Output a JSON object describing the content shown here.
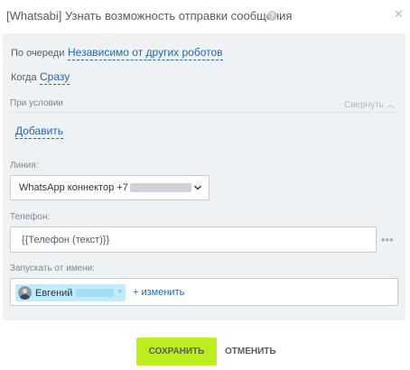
{
  "dialog": {
    "title": "[Whatsabi] Узнать возможность отправки сообщения",
    "help_icon": "question-circle-icon",
    "close_icon": "close-icon"
  },
  "queue": {
    "label": "По очереди",
    "value": "Независимо от других роботов"
  },
  "when": {
    "label": "Когда",
    "value": "Сразу"
  },
  "condition": {
    "label": "При условии",
    "collapse_label": "Свернуть",
    "add_label": "Добавить"
  },
  "line": {
    "label": "Линия:",
    "value": "WhatsApp коннектор +7"
  },
  "phone": {
    "label": "Телефон:",
    "value": "{{Телефон (текст)}}",
    "menu_label": "•••"
  },
  "run_as": {
    "label": "Запускать от имени:",
    "user_name": "Евгений",
    "remove_label": "×",
    "change_label": "+ изменить"
  },
  "footer": {
    "save_label": "СОХРАНИТЬ",
    "cancel_label": "ОТМЕНИТЬ"
  },
  "colors": {
    "accent": "#bbed21",
    "link": "#2067b0",
    "panel_bg": "#eef2f4",
    "chip_bg": "#bcedfc"
  }
}
